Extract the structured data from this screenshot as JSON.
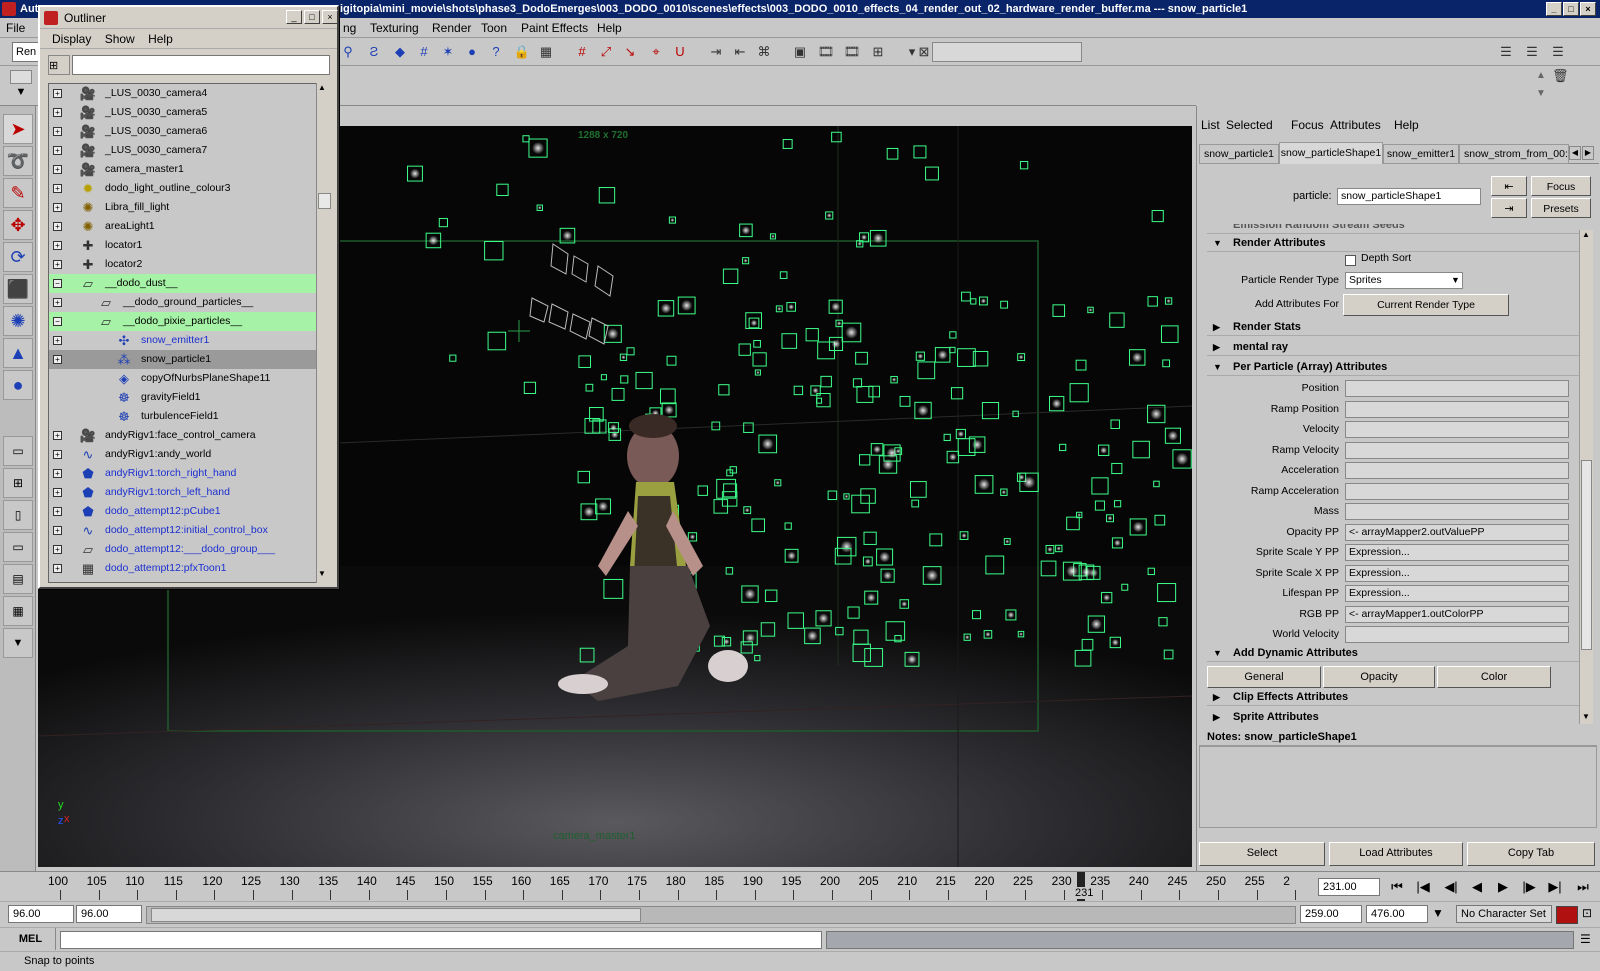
{
  "window": {
    "title": "Autodesk Maya - C:\\digitopia\\mini_movie\\shots\\phase3_DodoEmerges\\003_DODO_0010\\scenes\\effects\\003_DODO_0010_effects_04_render_out_02_hardware_render_buffer.ma  ---  snow_particle1",
    "title_visible_start": "Aut",
    "title_visible_path": "igitopia\\mini_movie\\shots\\phase3_DodoEmerges\\003_DODO_0010\\scenes\\effects\\003_DODO_0010_effects_04_render_out_02_hardware_render_buffer.ma  ---  snow_particle1"
  },
  "main_menu": {
    "file": "File",
    "items": [
      "ng",
      "Texturing",
      "Render",
      "Toon",
      "Paint Effects",
      "Help"
    ]
  },
  "mode_select": "Ren",
  "outliner": {
    "title": "Outliner",
    "menu": [
      "Display",
      "Show",
      "Help"
    ],
    "rows": [
      {
        "label": "_LUS_0030_camera4",
        "icon": "camera-icon",
        "exp": "+",
        "indent": 0,
        "state": "",
        "blue": false
      },
      {
        "label": "_LUS_0030_camera5",
        "icon": "camera-icon",
        "exp": "+",
        "indent": 0,
        "state": "",
        "blue": false
      },
      {
        "label": "_LUS_0030_camera6",
        "icon": "camera-icon",
        "exp": "+",
        "indent": 0,
        "state": "",
        "blue": false
      },
      {
        "label": "_LUS_0030_camera7",
        "icon": "camera-icon",
        "exp": "+",
        "indent": 0,
        "state": "",
        "blue": false
      },
      {
        "label": "camera_master1",
        "icon": "camera-icon",
        "exp": "+",
        "indent": 0,
        "state": "",
        "blue": false
      },
      {
        "label": "dodo_light_outline_colour3",
        "icon": "pointlight-icon",
        "exp": "+",
        "indent": 0,
        "state": "",
        "blue": false
      },
      {
        "label": "Libra_fill_light",
        "icon": "light-icon",
        "exp": "+",
        "indent": 0,
        "state": "",
        "blue": false
      },
      {
        "label": "areaLight1",
        "icon": "light-icon",
        "exp": "+",
        "indent": 0,
        "state": "",
        "blue": false
      },
      {
        "label": "locator1",
        "icon": "locator-icon",
        "exp": "+",
        "indent": 0,
        "state": "",
        "blue": false
      },
      {
        "label": "locator2",
        "icon": "locator-icon",
        "exp": "+",
        "indent": 0,
        "state": "",
        "blue": false
      },
      {
        "label": "__dodo_dust__",
        "icon": "group-icon",
        "exp": "−",
        "indent": 0,
        "state": "hl",
        "blue": false
      },
      {
        "label": "__dodo_ground_particles__",
        "icon": "group-icon",
        "exp": "+",
        "indent": 1,
        "state": "",
        "blue": false
      },
      {
        "label": "__dodo_pixie_particles__",
        "icon": "group-icon",
        "exp": "−",
        "indent": 1,
        "state": "hl",
        "blue": false
      },
      {
        "label": "snow_emitter1",
        "icon": "emitter-icon",
        "exp": "+",
        "indent": 2,
        "state": "",
        "blue": true
      },
      {
        "label": "snow_particle1",
        "icon": "particle-icon",
        "exp": "+",
        "indent": 2,
        "state": "sel",
        "blue": false
      },
      {
        "label": "copyOfNurbsPlaneShape11",
        "icon": "nurbs-icon",
        "exp": "",
        "indent": 2,
        "state": "",
        "blue": false
      },
      {
        "label": "gravityField1",
        "icon": "field-icon",
        "exp": "",
        "indent": 2,
        "state": "",
        "blue": false
      },
      {
        "label": "turbulenceField1",
        "icon": "field-icon",
        "exp": "",
        "indent": 2,
        "state": "",
        "blue": false
      },
      {
        "label": "andyRigv1:face_control_camera",
        "icon": "camera-icon",
        "exp": "+",
        "indent": 0,
        "state": "",
        "blue": false
      },
      {
        "label": "andyRigv1:andy_world",
        "icon": "curve-icon",
        "exp": "+",
        "indent": 0,
        "state": "",
        "blue": false
      },
      {
        "label": "andyRigv1:torch_right_hand",
        "icon": "mesh-icon",
        "exp": "+",
        "indent": 0,
        "state": "",
        "blue": true
      },
      {
        "label": "andyRigv1:torch_left_hand",
        "icon": "mesh-icon",
        "exp": "+",
        "indent": 0,
        "state": "",
        "blue": true
      },
      {
        "label": "dodo_attempt12:pCube1",
        "icon": "mesh-icon",
        "exp": "+",
        "indent": 0,
        "state": "",
        "blue": true
      },
      {
        "label": "dodo_attempt12:initial_control_box",
        "icon": "curve-icon",
        "exp": "+",
        "indent": 0,
        "state": "",
        "blue": true
      },
      {
        "label": "dodo_attempt12:___dodo_group___",
        "icon": "group-icon",
        "exp": "+",
        "indent": 0,
        "state": "",
        "blue": true
      },
      {
        "label": "dodo_attempt12:pfxToon1",
        "icon": "toon-icon",
        "exp": "+",
        "indent": 0,
        "state": "",
        "blue": true
      }
    ]
  },
  "viewport": {
    "resolution_label": "1288 x 720",
    "camera_label": "camera_master1",
    "axis_y": "y",
    "axis_x": "x",
    "axis_z": "z"
  },
  "attribute_editor": {
    "menu": [
      "List",
      "Selected",
      "Focus",
      "Attributes",
      "Help"
    ],
    "tabs": [
      "snow_particle1",
      "snow_particleShape1",
      "snow_emitter1",
      "snow_strom_from_00:"
    ],
    "particle_label": "particle:",
    "particle_value": "snow_particleShape1",
    "focus_button": "Focus",
    "presets_button": "Presets",
    "cut_section": "Emission Random Stream Seeds",
    "render_attributes": {
      "title": "Render Attributes",
      "depth_sort": "Depth Sort",
      "render_type_label": "Particle Render Type",
      "render_type_value": "Sprites",
      "add_attrs_label": "Add Attributes For",
      "add_attrs_button": "Current Render Type"
    },
    "render_stats": "Render Stats",
    "mental_ray": "mental ray",
    "per_particle": {
      "title": "Per Particle (Array) Attributes",
      "rows": [
        {
          "label": "Position",
          "value": ""
        },
        {
          "label": "Ramp Position",
          "value": ""
        },
        {
          "label": "Velocity",
          "value": ""
        },
        {
          "label": "Ramp Velocity",
          "value": ""
        },
        {
          "label": "Acceleration",
          "value": ""
        },
        {
          "label": "Ramp Acceleration",
          "value": ""
        },
        {
          "label": "Mass",
          "value": ""
        },
        {
          "label": "Opacity PP",
          "value": "<- arrayMapper2.outValuePP"
        },
        {
          "label": "Sprite Scale Y PP",
          "value": "Expression..."
        },
        {
          "label": "Sprite Scale X PP",
          "value": "Expression..."
        },
        {
          "label": "Lifespan PP",
          "value": "Expression..."
        },
        {
          "label": "RGB PP",
          "value": "<- arrayMapper1.outColorPP"
        },
        {
          "label": "World Velocity",
          "value": ""
        }
      ]
    },
    "dynamic": {
      "title": "Add Dynamic Attributes",
      "general": "General",
      "opacity": "Opacity",
      "color": "Color"
    },
    "clip_effects": "Clip Effects Attributes",
    "sprite": "Sprite Attributes",
    "notes_label": "Notes:  snow_particleShape1",
    "bottom_buttons": [
      "Select",
      "Load Attributes",
      "Copy Tab"
    ]
  },
  "timeline": {
    "ticks": [
      "100",
      "105",
      "110",
      "115",
      "120",
      "125",
      "130",
      "135",
      "140",
      "145",
      "150",
      "155",
      "160",
      "165",
      "170",
      "175",
      "180",
      "185",
      "190",
      "195",
      "200",
      "205",
      "210",
      "215",
      "220",
      "225",
      "230",
      "235",
      "240",
      "245",
      "250",
      "255",
      "2"
    ],
    "current_frame": "231",
    "current_frame_field": "231.00"
  },
  "range": {
    "start": "96.00",
    "start_inner": "96.00",
    "end_inner": "259.00",
    "end": "476.00",
    "character_set": "No Character Set"
  },
  "command_line": {
    "label": "MEL"
  },
  "help_line": "Snap to points",
  "colors": {
    "particle": "#3dff8a",
    "highlight_row": "#a6f2a6",
    "selected_row": "#9a9a9a",
    "title_bar": "#0a246a"
  }
}
